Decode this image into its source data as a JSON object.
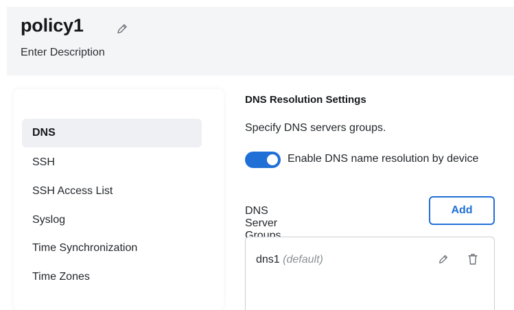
{
  "header": {
    "title": "policy1",
    "description": "Enter Description"
  },
  "sidebar": {
    "items": [
      {
        "label": "DNS",
        "active": true
      },
      {
        "label": "SSH",
        "active": false
      },
      {
        "label": "SSH Access List",
        "active": false
      },
      {
        "label": "Syslog",
        "active": false
      },
      {
        "label": "Time Synchronization",
        "active": false
      },
      {
        "label": "Time Zones",
        "active": false
      }
    ]
  },
  "main": {
    "section_title": "DNS Resolution Settings",
    "section_subtitle": "Specify DNS servers groups.",
    "toggle": {
      "label": "Enable DNS name resolution by device",
      "on": true
    },
    "groups_label": "DNS Server Groups",
    "add_label": "Add",
    "groups": [
      {
        "name": "dns1",
        "tag": "(default)"
      }
    ]
  },
  "colors": {
    "accent": "#1f6fd6",
    "header_bg": "#f4f5f7",
    "active_nav_bg": "#eef0f3"
  },
  "icons": {
    "title_edit": "pencil-icon",
    "row_edit": "pencil-icon",
    "row_delete": "trash-icon"
  }
}
